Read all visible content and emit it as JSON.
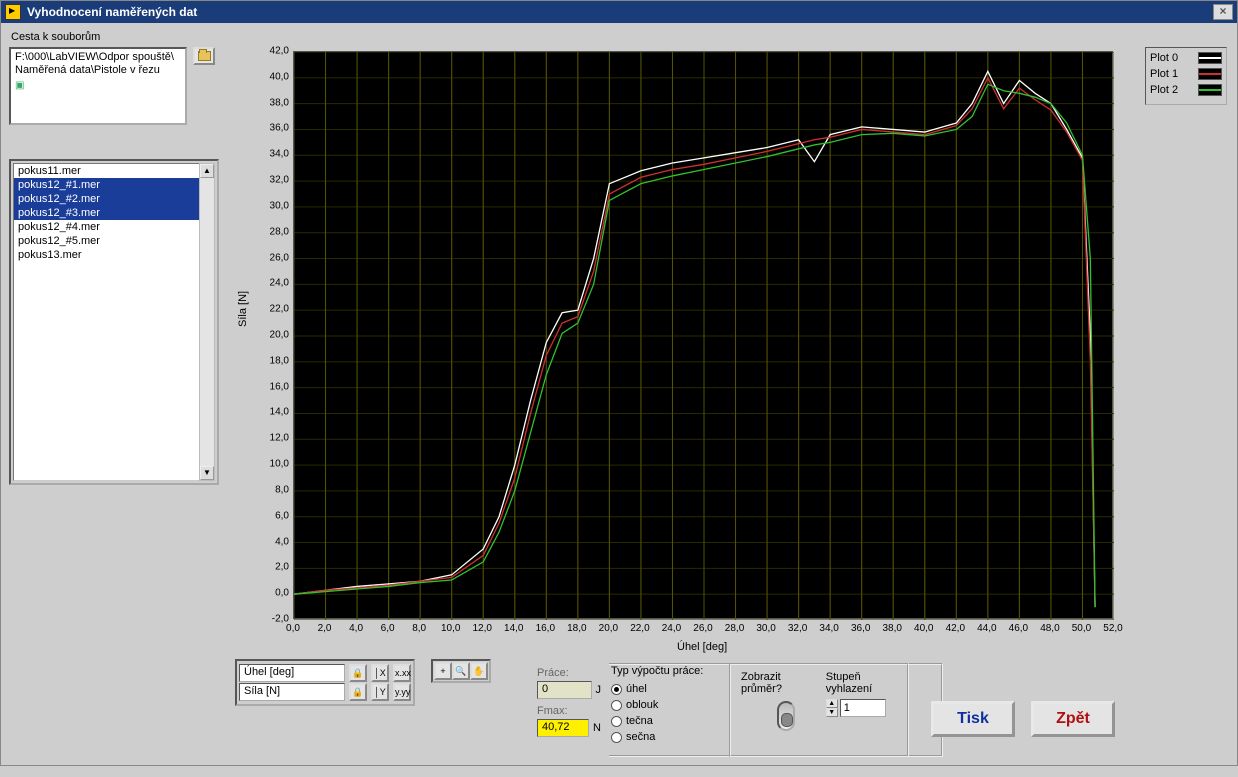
{
  "window": {
    "title": "Vyhodnocení naměřených dat"
  },
  "path": {
    "label": "Cesta k souborům",
    "value_line1": "F:\\000\\LabVIEW\\Odpor spouště\\",
    "value_line2": "Naměřená data\\Pistole v řezu"
  },
  "files": {
    "items": [
      {
        "name": "pokus11.mer",
        "selected": false
      },
      {
        "name": "pokus12_#1.mer",
        "selected": true
      },
      {
        "name": "pokus12_#2.mer",
        "selected": true
      },
      {
        "name": "pokus12_#3.mer",
        "selected": true
      },
      {
        "name": "pokus12_#4.mer",
        "selected": false
      },
      {
        "name": "pokus12_#5.mer",
        "selected": false
      },
      {
        "name": "pokus13.mer",
        "selected": false
      }
    ]
  },
  "legend": {
    "items": [
      {
        "label": "Plot 0",
        "color": "#ffffff"
      },
      {
        "label": "Plot 1",
        "color": "#d03030"
      },
      {
        "label": "Plot 2",
        "color": "#30c030"
      }
    ]
  },
  "axes": {
    "x_name": "Úhel [deg]",
    "y_name": "Síla [N]"
  },
  "calc": {
    "prace_label": "Práce:",
    "prace_value": "0",
    "prace_unit": "J",
    "fmax_label": "Fmax:",
    "fmax_value": "40,72",
    "fmax_unit": "N"
  },
  "work_type": {
    "header": "Typ výpočtu práce:",
    "options": [
      {
        "label": "úhel",
        "checked": true
      },
      {
        "label": "oblouk",
        "checked": false
      },
      {
        "label": "tečna",
        "checked": false
      },
      {
        "label": "sečna",
        "checked": false
      }
    ]
  },
  "average": {
    "show_label": "Zobrazit průměr?",
    "smooth_label": "Stupeň vyhlazení",
    "smooth_value": "1"
  },
  "buttons": {
    "print": "Tisk",
    "back": "Zpět"
  },
  "chart_data": {
    "type": "line",
    "xlabel": "Úhel [deg]",
    "ylabel": "Síla [N]",
    "xlim": [
      0,
      52
    ],
    "ylim": [
      -2,
      42
    ],
    "x": [
      0,
      2,
      4,
      6,
      8,
      10,
      12,
      13,
      14,
      15,
      16,
      17,
      18,
      19,
      20,
      22,
      24,
      26,
      28,
      30,
      32,
      33,
      34,
      36,
      38,
      40,
      42,
      43,
      44,
      45,
      46,
      47,
      48,
      49,
      50,
      50.5,
      50.8
    ],
    "series": [
      {
        "name": "Plot 0",
        "color": "#ffffff",
        "values": [
          0.0,
          0.3,
          0.6,
          0.8,
          1.0,
          1.5,
          3.5,
          6.0,
          10.0,
          15.0,
          19.5,
          21.8,
          22.0,
          26.0,
          31.8,
          32.8,
          33.4,
          33.8,
          34.2,
          34.6,
          35.2,
          33.5,
          35.6,
          36.2,
          36.0,
          35.8,
          36.5,
          38.0,
          40.5,
          38.0,
          39.8,
          38.8,
          38.0,
          36.0,
          33.8,
          20.0,
          -1.0
        ]
      },
      {
        "name": "Plot 1",
        "color": "#d03030",
        "values": [
          0.0,
          0.3,
          0.5,
          0.7,
          1.0,
          1.3,
          3.0,
          5.5,
          9.0,
          14.0,
          18.5,
          21.0,
          21.5,
          25.0,
          31.0,
          32.3,
          32.9,
          33.3,
          33.8,
          34.3,
          34.9,
          35.2,
          35.4,
          36.0,
          35.8,
          35.6,
          36.3,
          37.6,
          40.0,
          37.6,
          39.2,
          38.3,
          37.5,
          35.8,
          33.6,
          18.0,
          -1.0
        ]
      },
      {
        "name": "Plot 2",
        "color": "#30c030",
        "values": [
          0.0,
          0.2,
          0.4,
          0.6,
          0.9,
          1.1,
          2.5,
          4.8,
          8.0,
          12.5,
          17.0,
          20.2,
          21.0,
          24.0,
          30.5,
          31.8,
          32.4,
          32.9,
          33.4,
          33.9,
          34.5,
          34.8,
          35.0,
          35.6,
          35.7,
          35.5,
          36.0,
          37.0,
          39.5,
          39.0,
          38.8,
          38.5,
          38.0,
          36.5,
          34.0,
          26.0,
          -1.0
        ]
      }
    ]
  }
}
